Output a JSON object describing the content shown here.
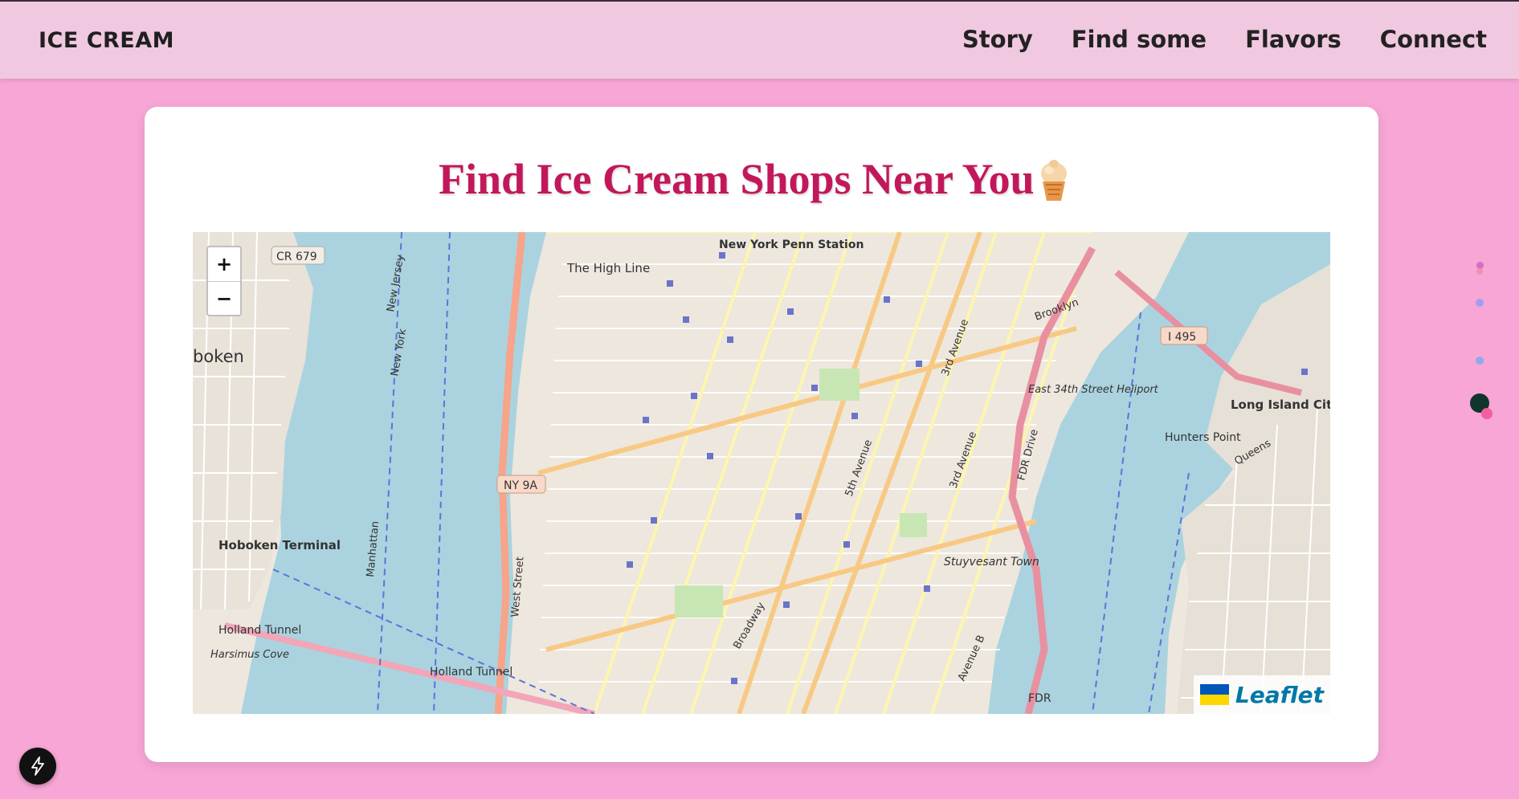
{
  "brand": "ICE CREAM",
  "nav": [
    "Story",
    "Find some",
    "Flavors",
    "Connect"
  ],
  "page_title": "Find Ice Cream Shops Near You",
  "title_icon": "ice-cream-cone-icon",
  "map": {
    "zoom_in": "+",
    "zoom_out": "−",
    "attribution": "Leaflet",
    "labels": {
      "hoboken": "boken",
      "hoboken_terminal": "Hoboken Terminal",
      "high_line": "The High Line",
      "penn_station": "New York Penn Station",
      "ny9a": "NY 9A",
      "cr679": "CR 679",
      "i495": "I 495",
      "east34": "East 34th Street Heliport",
      "lic": "Long Island City",
      "hunters": "Hunters Point",
      "stuy": "Stuyvesant Town",
      "holland1": "Holland Tunnel",
      "holland2": "Holland Tunnel",
      "fifth": "5th Avenue",
      "third": "3rd Avenue",
      "third2": "3rd Avenue",
      "broadway": "Broadway",
      "fdr": "FDR Drive",
      "fdr2": "FDR",
      "west_st": "West Street",
      "avenue_b": "Avenue B",
      "manhattan": "Manhattan",
      "new_jersey": "New Jersey",
      "new_york": "New York",
      "brooklyn": "Brooklyn",
      "queens": "Queens",
      "harsimus": "Harsimus Cove"
    }
  },
  "colors": {
    "page_bg": "#f7a6d5",
    "navbar_bg": "#f0c8df",
    "title": "#c2185b",
    "water": "#aad3df",
    "land": "#ede7de",
    "major_road": "#f8c984",
    "minor_road": "#fdf5b0",
    "highway": "#e890a0"
  }
}
